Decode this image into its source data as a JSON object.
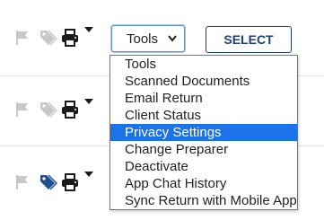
{
  "colors": {
    "accent": "#1a73e8",
    "button_text": "#1d3f7a",
    "icon_gray": "#c8c8c8",
    "icon_dark": "#1b1b1b",
    "tag_active": "#1d4f91"
  },
  "rows": [
    {
      "icons": [
        "flag-icon",
        "tag-icon",
        "printer-icon",
        "chevron-down-icon"
      ],
      "tag_active": false
    },
    {
      "icons": [
        "flag-icon",
        "tag-icon",
        "printer-icon",
        "chevron-down-icon"
      ],
      "tag_active": false
    },
    {
      "icons": [
        "flag-icon",
        "tag-icon",
        "printer-icon",
        "chevron-down-icon"
      ],
      "tag_active": true
    }
  ],
  "tools_select": {
    "value": "Tools",
    "options": [
      "Tools",
      "Scanned Documents",
      "Email Return",
      "Client Status",
      "Privacy Settings",
      "Change Preparer",
      "Deactivate",
      "App Chat History",
      "Sync Return with Mobile App"
    ],
    "highlighted": "Privacy Settings"
  },
  "select_button": {
    "label": "SELECT"
  }
}
